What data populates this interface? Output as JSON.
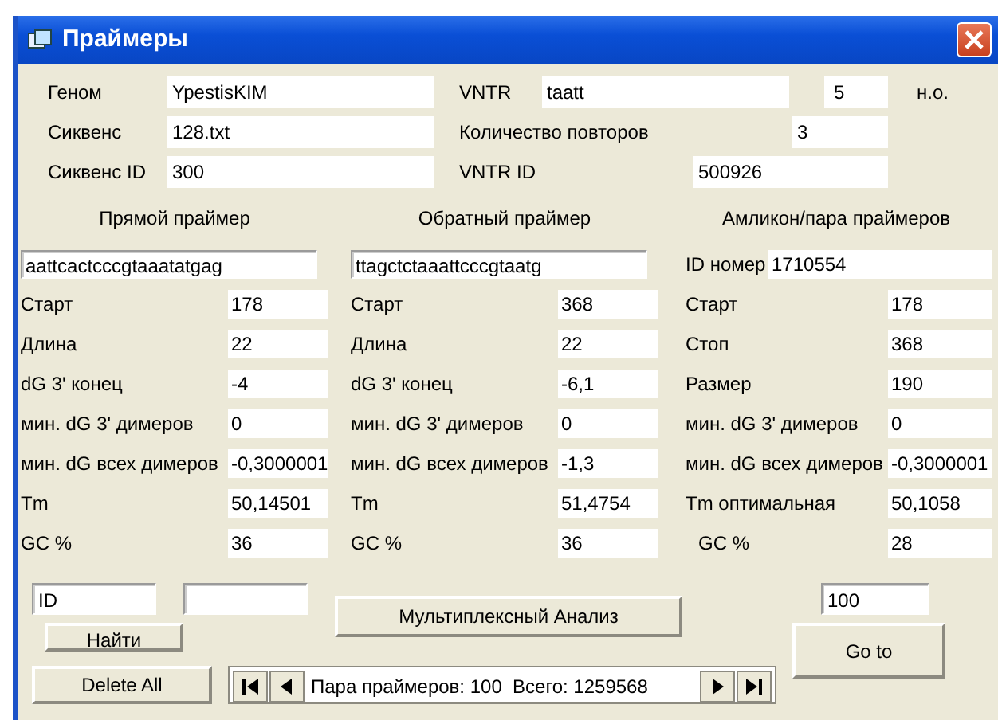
{
  "window": {
    "title": "Праймеры"
  },
  "header_left": [
    {
      "label": "Геном",
      "value": "YpestisKIM"
    },
    {
      "label": "Сиквенс",
      "value": "128.txt"
    },
    {
      "label": "Сиквенс ID",
      "value": "300"
    }
  ],
  "header_right": [
    {
      "label": "VNTR",
      "value": "taatt",
      "extra_value": "5",
      "unit": "н.о."
    },
    {
      "label": "Количество повторов",
      "value": "3"
    },
    {
      "label": "VNTR ID",
      "value": "500926"
    }
  ],
  "columns": [
    {
      "kind": "primer",
      "title": "Прямой праймер",
      "sequence": "aattcactcccgtaaatatgag",
      "rows": [
        {
          "label": "Старт",
          "value": "178"
        },
        {
          "label": "Длина",
          "value": "22"
        },
        {
          "label": "dG 3' конец",
          "value": "-4"
        },
        {
          "label": "мин. dG 3' димеров",
          "value": "0"
        },
        {
          "label": "мин. dG всех димеров",
          "value": "-0,3000001"
        },
        {
          "label": "Tm",
          "value": "50,14501"
        },
        {
          "label": "GC %",
          "value": "36"
        }
      ]
    },
    {
      "kind": "primer",
      "title": "Обратный праймер",
      "sequence": "ttagctctaaattcccgtaatg",
      "rows": [
        {
          "label": "Старт",
          "value": "368"
        },
        {
          "label": "Длина",
          "value": "22"
        },
        {
          "label": "dG 3' конец",
          "value": "-6,1"
        },
        {
          "label": "мин. dG 3' димеров",
          "value": "0"
        },
        {
          "label": "мин. dG всех димеров",
          "value": "-1,3"
        },
        {
          "label": "Tm",
          "value": "51,4754"
        },
        {
          "label": "GC %",
          "value": "36"
        }
      ]
    },
    {
      "kind": "amplicon",
      "title": "Амликон/пара праймеров",
      "id_label": "ID номер",
      "id_value": "1710554",
      "rows": [
        {
          "label": "Старт",
          "value": "178"
        },
        {
          "label": "Стоп",
          "value": "368"
        },
        {
          "label": "Размер",
          "value": "190"
        },
        {
          "label": "мин. dG 3' димеров",
          "value": "0"
        },
        {
          "label": "мин. dG всех димеров",
          "value": "-0,3000001"
        },
        {
          "label": "Tm оптимальная",
          "value": "50,1058"
        },
        {
          "label": "GC %",
          "value": "28"
        }
      ]
    }
  ],
  "search": {
    "id_field": "ID",
    "find_button": "Найти"
  },
  "multiplex_button": "Мультиплексный Анализ",
  "goto": {
    "field": "100",
    "button": "Go to"
  },
  "delete_button": "Delete All",
  "navigator": {
    "text": "Пара праймеров: 100  Всего: 1259568"
  }
}
